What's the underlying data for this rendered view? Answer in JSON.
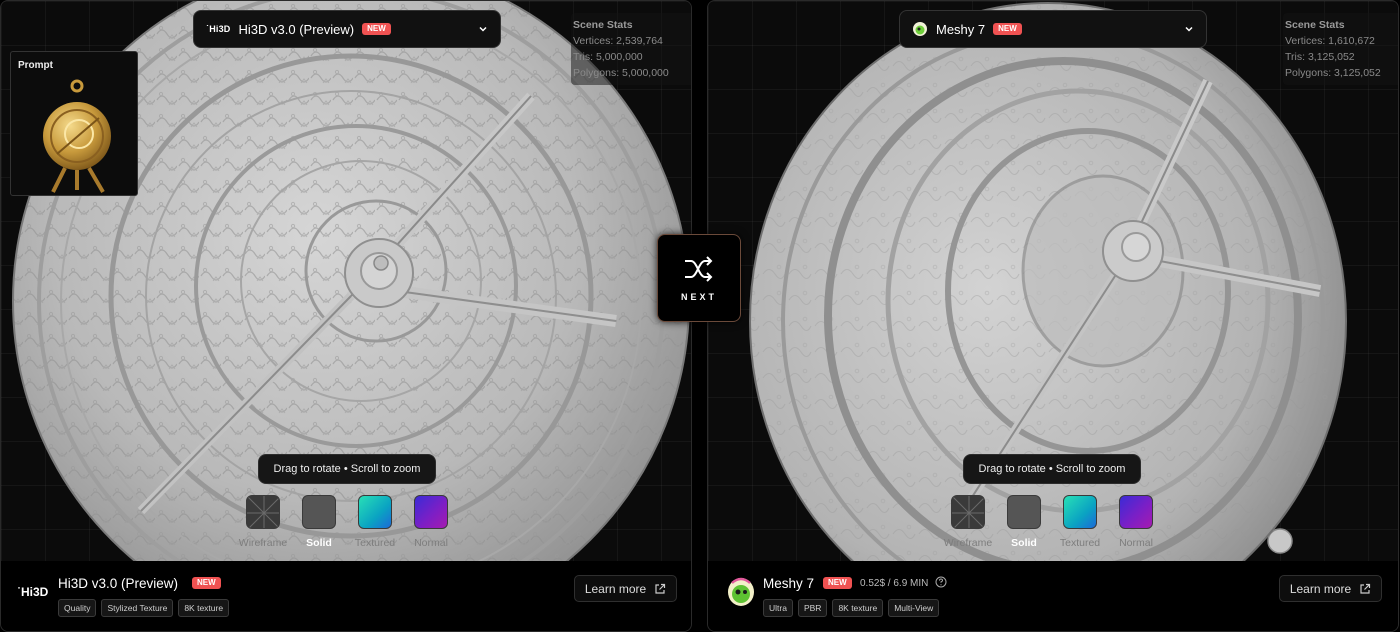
{
  "left_panel": {
    "model_select": {
      "logo": "˙Hi3D",
      "name": "Hi3D v3.0 (Preview)",
      "badge": "NEW"
    },
    "scene_stats": {
      "title": "Scene Stats",
      "vertices": "Vertices: 2,539,764",
      "tris": "Tris: 5,000,000",
      "polygons": "Polygons: 5,000,000"
    },
    "prompt": {
      "label": "Prompt"
    },
    "hint": "Drag to rotate • Scroll to zoom",
    "modes": [
      {
        "label": "Wireframe",
        "icon": "wireframe-swatch-icon"
      },
      {
        "label": "Solid",
        "icon": "solid-swatch-icon"
      },
      {
        "label": "Textured",
        "icon": "textured-swatch-icon"
      },
      {
        "label": "Normal",
        "icon": "normal-swatch-icon"
      }
    ],
    "active_mode": "Solid",
    "footer": {
      "logo": "˙Hi3D",
      "name": "Hi3D v3.0 (Preview)",
      "badge": "NEW",
      "tags": [
        "Quality",
        "Stylized Texture",
        "8K texture"
      ],
      "learn_more": "Learn more"
    }
  },
  "right_panel": {
    "model_select": {
      "name": "Meshy 7",
      "badge": "NEW"
    },
    "scene_stats": {
      "title": "Scene Stats",
      "vertices": "Vertices: 1,610,672",
      "tris": "Tris: 3,125,052",
      "polygons": "Polygons: 3,125,052"
    },
    "hint": "Drag to rotate • Scroll to zoom",
    "modes": [
      {
        "label": "Wireframe",
        "icon": "wireframe-swatch-icon"
      },
      {
        "label": "Solid",
        "icon": "solid-swatch-icon"
      },
      {
        "label": "Textured",
        "icon": "textured-swatch-icon"
      },
      {
        "label": "Normal",
        "icon": "normal-swatch-icon"
      }
    ],
    "active_mode": "Solid",
    "footer": {
      "name": "Meshy 7",
      "badge": "NEW",
      "price": "0.52$ / 6.9 MIN",
      "tags": [
        "Ultra",
        "PBR",
        "8K texture",
        "Multi-View"
      ],
      "learn_more": "Learn more"
    }
  },
  "next_button": {
    "label": "NEXT",
    "icon": "shuffle-icon"
  },
  "colors": {
    "badge": "#f05252",
    "next_border": "#6b4a3a",
    "textured_swatch": "#1fd0c0",
    "normal_swatch": "#6b25cc"
  }
}
